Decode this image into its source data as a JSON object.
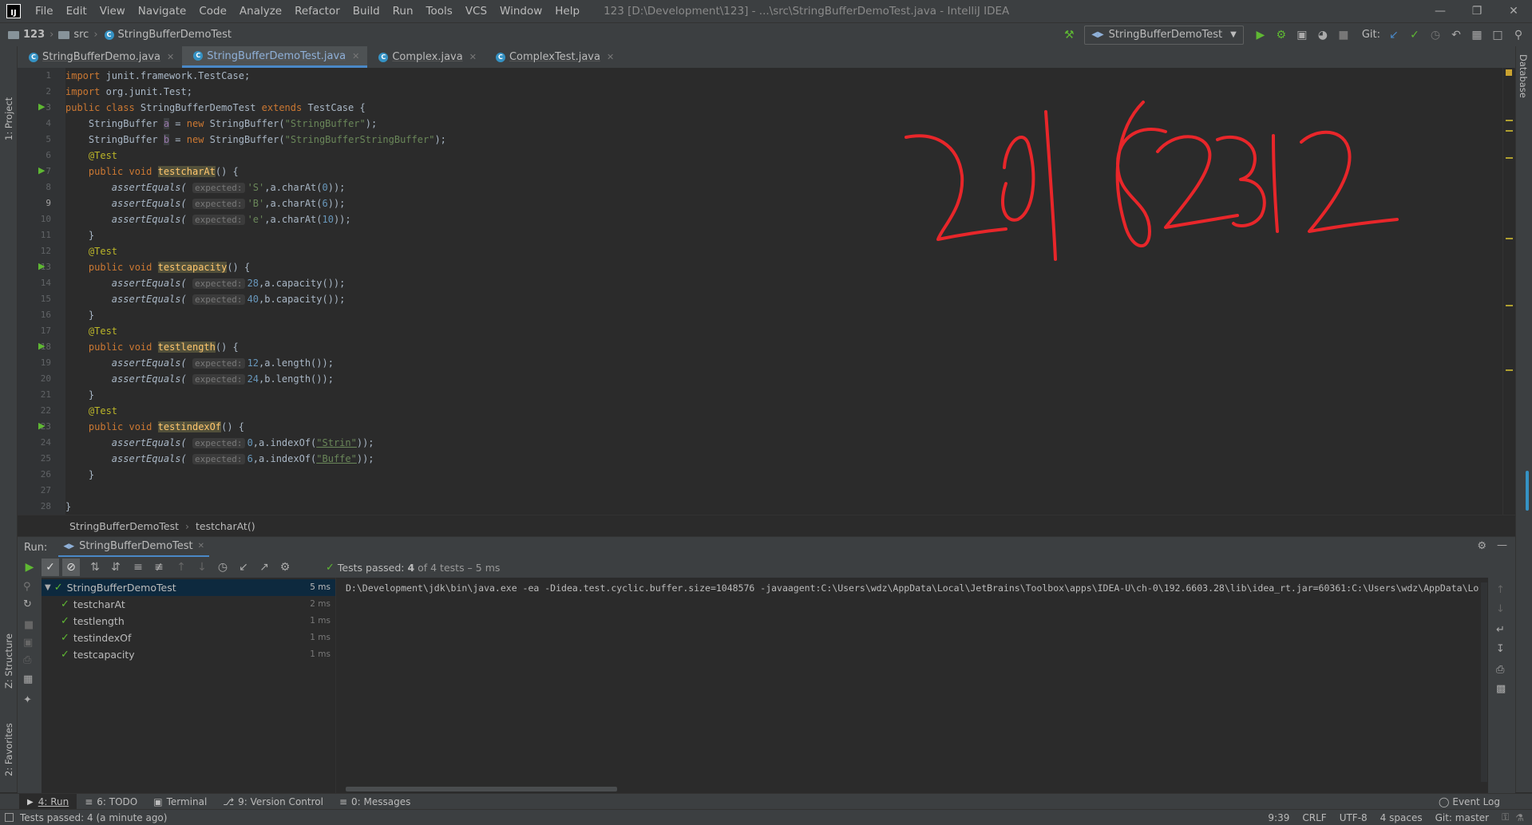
{
  "app": {
    "logo": "IJ",
    "window_title": "123 [D:\\Development\\123] - ...\\src\\StringBufferDemoTest.java - IntelliJ IDEA"
  },
  "menu": [
    "File",
    "Edit",
    "View",
    "Navigate",
    "Code",
    "Analyze",
    "Refactor",
    "Build",
    "Run",
    "Tools",
    "VCS",
    "Window",
    "Help"
  ],
  "navbar": {
    "crumbs": [
      "123",
      "src",
      "StringBufferDemoTest"
    ],
    "run_config": "StringBufferDemoTest",
    "git_label": "Git:"
  },
  "tabs": [
    {
      "label": "StringBufferDemo.java",
      "active": false
    },
    {
      "label": "StringBufferDemoTest.java",
      "active": true
    },
    {
      "label": "Complex.java",
      "active": false
    },
    {
      "label": "ComplexTest.java",
      "active": false
    }
  ],
  "left_strip": {
    "project": "1: Project",
    "structure": "Z: Structure",
    "favorites": "2: Favorites"
  },
  "right_strip": {
    "database": "Database"
  },
  "code": {
    "hint_expected": "expected:",
    "lines": [
      "1",
      "2",
      "3",
      "4",
      "5",
      "6",
      "7",
      "8",
      "9",
      "10",
      "11",
      "12",
      "13",
      "14",
      "15",
      "16",
      "17",
      "18",
      "19",
      "20",
      "21",
      "22",
      "23",
      "24",
      "25",
      "26",
      "27",
      "28"
    ],
    "l1": {
      "kw": "import",
      "rest": " junit.framework.TestCase;"
    },
    "l2": {
      "kw": "import",
      "rest": " org.junit.Test;"
    },
    "l3": {
      "kw1": "public class",
      "name": " StringBufferDemoTest ",
      "kw2": "extends",
      "rest": " TestCase {"
    },
    "l4": {
      "a": "    StringBuffer ",
      "v": "a",
      "b": " = ",
      "kw": "new",
      "c": " StringBuffer(",
      "s": "\"StringBuffer\"",
      "d": ");"
    },
    "l5": {
      "a": "    StringBuffer ",
      "v": "b",
      "b": " = ",
      "kw": "new",
      "c": " StringBuffer(",
      "s": "\"StringBufferStringBuffer\"",
      "d": ");"
    },
    "ann": "@Test",
    "pv": "public void",
    "m1": "testcharAt",
    "m2": "testcapacity",
    "m3": "testlength",
    "m4": "testindexOf",
    "sig_end": "() {",
    "assert": "assertEquals(",
    "l8": {
      "s": "'S'",
      "r": ",a.charAt(",
      "n": "0",
      "e": "));"
    },
    "l9": {
      "s": "'B'",
      "r": ",a.charAt(",
      "n": "6",
      "e": "));"
    },
    "l10": {
      "s": "'e'",
      "r": ",a.charAt(",
      "n": "10",
      "e": "));"
    },
    "l14": {
      "n": "28",
      "r": ",a.capacity());"
    },
    "l15": {
      "n": "40",
      "r": ",b.capacity());"
    },
    "l19": {
      "n": "12",
      "r": ",a.length());"
    },
    "l20": {
      "n": "24",
      "r": ",b.length());"
    },
    "l24": {
      "n": "0",
      "r": ",a.indexOf(",
      "s": "\"Strin\"",
      "e": "));"
    },
    "l25": {
      "n": "6",
      "r": ",a.indexOf(",
      "s": "\"Buffe\"",
      "e": "));"
    },
    "close_in": "    }",
    "close_out": "}"
  },
  "editor_crumbs": [
    "StringBufferDemoTest",
    "testcharAt()"
  ],
  "run": {
    "label": "Run:",
    "tab": "StringBufferDemoTest",
    "status_prefix": "Tests passed: ",
    "status_count": "4",
    "status_suffix": " of 4 tests – 5 ms",
    "tree": [
      {
        "name": "StringBufferDemoTest",
        "time": "5 ms"
      },
      {
        "name": "testcharAt",
        "time": "2 ms"
      },
      {
        "name": "testlength",
        "time": "1 ms"
      },
      {
        "name": "testindexOf",
        "time": "1 ms"
      },
      {
        "name": "testcapacity",
        "time": "1 ms"
      }
    ],
    "console_line": "D:\\Development\\jdk\\bin\\java.exe -ea -Didea.test.cyclic.buffer.size=1048576 -javaagent:C:\\Users\\wdz\\AppData\\Local\\JetBrains\\Toolbox\\apps\\IDEA-U\\ch-0\\192.6603.28\\lib\\idea_rt.jar=60361:C:\\Users\\wdz\\AppData\\Lo"
  },
  "bottom_tools": [
    {
      "label": "4: Run",
      "icon": "run-icon",
      "active": true
    },
    {
      "label": "6: TODO",
      "icon": "todo-icon",
      "active": false
    },
    {
      "label": "Terminal",
      "icon": "terminal-icon",
      "active": false
    },
    {
      "label": "9: Version Control",
      "icon": "vcs-icon",
      "active": false
    },
    {
      "label": "0: Messages",
      "icon": "messages-icon",
      "active": false
    }
  ],
  "event_log": "Event Log",
  "status": {
    "message": "Tests passed: 4 (a minute ago)",
    "position": "9:39",
    "line_sep": "CRLF",
    "encoding": "UTF-8",
    "indent": "4 spaces",
    "git": "Git: master"
  },
  "overlay_handwriting": "20182312",
  "colors": {
    "accent": "#4a88c7",
    "pass": "#5fb833",
    "ink": "#e8262a"
  }
}
